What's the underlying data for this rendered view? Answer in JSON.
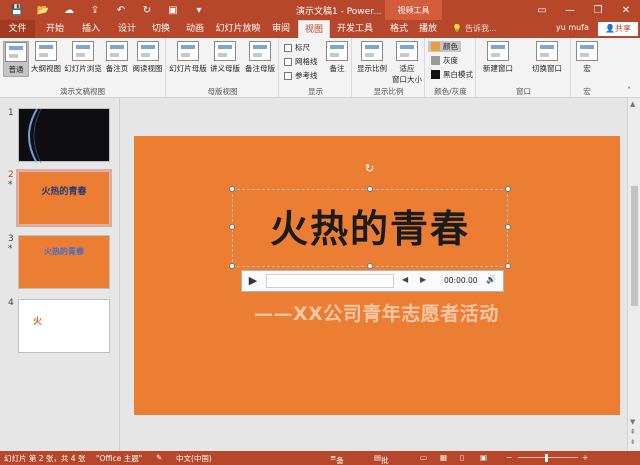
{
  "title_bar": {
    "doc_title": "演示文稿1 - Power...",
    "context_tool": "视频工具",
    "controls": [
      "▭",
      "—",
      "❐",
      "✕"
    ]
  },
  "tabs": [
    {
      "label": "文件"
    },
    {
      "label": "开始"
    },
    {
      "label": "插入"
    },
    {
      "label": "设计"
    },
    {
      "label": "切换"
    },
    {
      "label": "动画"
    },
    {
      "label": "幻灯片放映"
    },
    {
      "label": "审阅"
    },
    {
      "label": "视图"
    },
    {
      "label": "开发工具"
    },
    {
      "label": "格式"
    },
    {
      "label": "播放"
    }
  ],
  "tell_me": {
    "placeholder": "告诉我..."
  },
  "user": {
    "name": "yu mufa",
    "share": "共享"
  },
  "ribbon": {
    "presentation_views": {
      "label": "演示文稿视图",
      "buttons": [
        "普通",
        "大纲视图",
        "幻灯片浏览",
        "备注页",
        "阅读视图"
      ]
    },
    "master_views": {
      "label": "母版视图",
      "buttons": [
        "幻灯片母版",
        "讲义母版",
        "备注母版"
      ]
    },
    "show": {
      "label": "显示",
      "checks": [
        "标尺",
        "网格线",
        "参考线"
      ],
      "notes": "备注"
    },
    "zoom": {
      "label": "显示比例",
      "buttons": [
        "显示比例",
        "适应\n窗口大小"
      ]
    },
    "color": {
      "label": "颜色/灰度",
      "items": [
        {
          "label": "颜色",
          "swatch": "#e7a03a"
        },
        {
          "label": "灰度",
          "swatch": "#9a9a9a"
        },
        {
          "label": "黑白模式",
          "swatch": "#111111"
        }
      ]
    },
    "window": {
      "label": "窗口",
      "buttons": [
        "新建窗口",
        "切换窗口"
      ]
    },
    "macro": {
      "label": "宏",
      "button": "宏"
    }
  },
  "slides": [
    {
      "num": "1",
      "star": "",
      "text": ""
    },
    {
      "num": "2",
      "star": "*",
      "text": "火热的青春"
    },
    {
      "num": "3",
      "star": "*",
      "text": "火热的青春"
    },
    {
      "num": "4",
      "star": "",
      "text": "火"
    }
  ],
  "slide": {
    "title": "火热的青春",
    "subtitle": "——XX公司青年志愿者活动",
    "player_time": "00:00.00"
  },
  "status": {
    "slide_info": "幻灯片 第 2 张，共 4 张",
    "theme": "\"Office 主题\"",
    "language": "中文(中国)",
    "notes": "备注",
    "comments": "批注"
  },
  "colors": {
    "accent": "#b7472a",
    "slide_bg": "#ec7e34"
  }
}
